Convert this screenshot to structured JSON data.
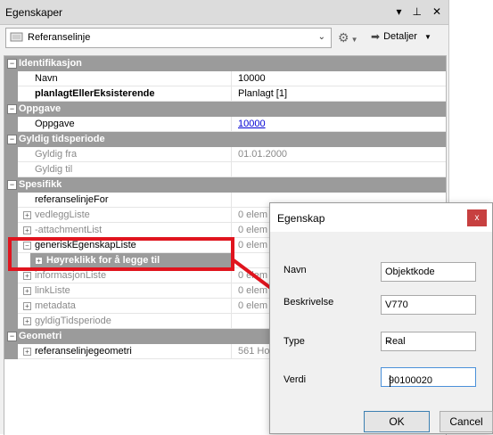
{
  "panel": {
    "title": "Egenskaper",
    "pin_icon": "pin-icon",
    "close_icon": "close-icon"
  },
  "toolbar": {
    "object_type": "Referanselinje",
    "details_label": "Detaljer"
  },
  "grid": {
    "categories": {
      "ident": "Identifikasjon",
      "oppgave": "Oppgave",
      "gyldig": "Gyldig tidsperiode",
      "spesifikk": "Spesifikk",
      "geometri": "Geometri"
    },
    "rows": {
      "navn": {
        "name": "Navn",
        "value": "10000"
      },
      "planlagt": {
        "name": "planlagtEllerEksisterende",
        "value": "Planlagt [1]"
      },
      "oppgave": {
        "name": "Oppgave",
        "value": "10000"
      },
      "gyldig_fra": {
        "name": "Gyldig fra",
        "value": "01.01.2000"
      },
      "gyldig_til": {
        "name": "Gyldig til",
        "value": ""
      },
      "referanselinjeFor": {
        "name": "referanselinjeFor",
        "value": ""
      },
      "vedleggListe": {
        "name": "vedleggListe",
        "value": "0 elem"
      },
      "attachmentList": {
        "name": "-attachmentList",
        "value": "0 elem"
      },
      "generiskEgenskapListe": {
        "name": "generiskEgenskapListe",
        "value": "0 elem"
      },
      "hoyreklikk": {
        "name": "Høyreklikk for å legge til",
        "value": ""
      },
      "informasjonListe": {
        "name": "informasjonListe",
        "value": "0 elem"
      },
      "linkListe": {
        "name": "linkListe",
        "value": "0 elem"
      },
      "metadata": {
        "name": "metadata",
        "value": "0 elem"
      },
      "gyldigTidsperiode": {
        "name": "gyldigTidsperiode",
        "value": ""
      },
      "referanselinjegeometri": {
        "name": "referanselinjegeometri",
        "value": "561 Ho"
      }
    }
  },
  "dialog": {
    "title": "Egenskap",
    "close_label": "x",
    "navn_label": "Navn",
    "navn_value": "Objektkode",
    "beskrivelse_label": "Beskrivelse",
    "beskrivelse_value": "V770",
    "type_label": "Type",
    "type_value": "Real",
    "verdi_label": "Verdi",
    "verdi_value": "90100020",
    "ok_label": "OK",
    "cancel_label": "Cancel"
  },
  "colors": {
    "category_bg": "#9b9b9b",
    "highlight": "#e0141e",
    "link": "#0000d4"
  }
}
